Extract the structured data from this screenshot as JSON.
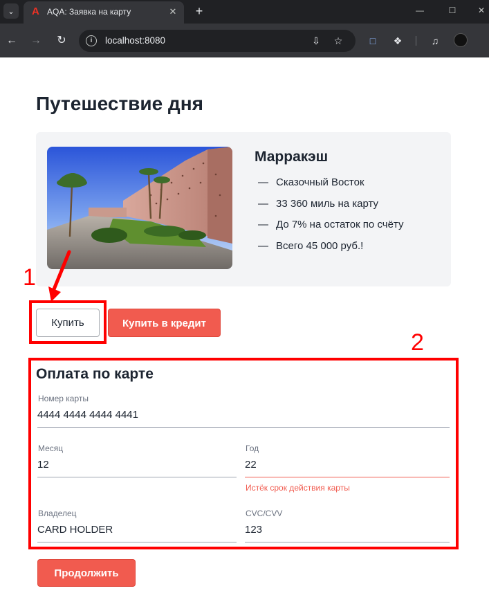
{
  "browser": {
    "tab_title": "AQA: Заявка на карту",
    "url": "localhost:8080",
    "accent_color": "#ef3124"
  },
  "page": {
    "title": "Путешествие дня"
  },
  "offer": {
    "city": "Марракэш",
    "features": [
      "Сказочный Восток",
      "33 360 миль на карту",
      "До 7% на остаток по счёту",
      "Всего 45 000 руб.!"
    ],
    "dash": "—"
  },
  "buttons": {
    "buy": "Купить",
    "buy_credit": "Купить в кредит",
    "continue": "Продолжить"
  },
  "payment_form": {
    "title": "Оплата по карте",
    "card_number": {
      "label": "Номер карты",
      "value": "4444 4444 4444 4441"
    },
    "month": {
      "label": "Месяц",
      "value": "12"
    },
    "year": {
      "label": "Год",
      "value": "22",
      "error": "Истёк срок действия карты"
    },
    "owner": {
      "label": "Владелец",
      "value": "CARD HOLDER"
    },
    "cvc": {
      "label": "CVC/CVV",
      "value": "123"
    }
  },
  "annotations": {
    "marker_1": "1",
    "marker_2": "2",
    "color": "#ff0000"
  },
  "colors": {
    "primary_red": "#f15b4f",
    "text_dark": "#1c2430",
    "card_bg": "#f3f4f6"
  }
}
